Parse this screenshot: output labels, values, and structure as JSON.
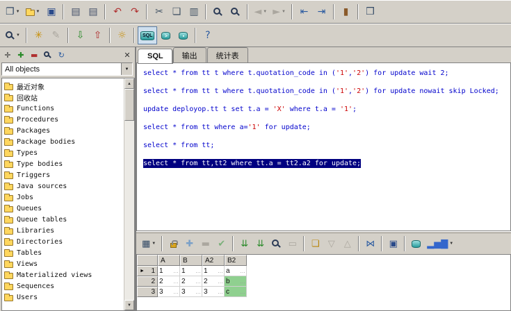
{
  "icons": {
    "dropdown": "▼",
    "row_marker": "►",
    "scroll_up": "▲",
    "scroll_down": "▼"
  },
  "toolbar_main": {
    "groups": [
      [
        {
          "name": "new-file",
          "g": "❐",
          "c": "#334a66",
          "dd": true
        },
        {
          "name": "open-file",
          "k": "folder",
          "dd": true
        },
        {
          "name": "save",
          "g": "▣",
          "c": "#2a4a8a"
        }
      ],
      [
        {
          "name": "print",
          "g": "▤",
          "c": "#44506a"
        },
        {
          "name": "print-options",
          "g": "▤",
          "c": "#44506a"
        }
      ],
      [
        {
          "name": "undo",
          "g": "↶",
          "c": "#b03030"
        },
        {
          "name": "redo",
          "g": "↷",
          "c": "#b03030"
        }
      ],
      [
        {
          "name": "cut",
          "g": "✂",
          "c": "#445566"
        },
        {
          "name": "copy",
          "g": "❏",
          "c": "#445566"
        },
        {
          "name": "paste",
          "g": "▥",
          "c": "#445566"
        }
      ],
      [
        {
          "name": "find",
          "k": "mag"
        },
        {
          "name": "find-next",
          "k": "mag"
        }
      ],
      [
        {
          "name": "back",
          "g": "◄",
          "dis": true,
          "dd": true
        },
        {
          "name": "forward",
          "g": "►",
          "dis": true,
          "dd": true
        }
      ],
      [
        {
          "name": "unindent",
          "g": "⇤",
          "c": "#2a5aa0"
        },
        {
          "name": "indent",
          "g": "⇥",
          "c": "#2a5aa0"
        }
      ],
      [
        {
          "name": "exit",
          "g": "▮",
          "c": "#8a5a2a"
        }
      ],
      [
        {
          "name": "window-list",
          "g": "❒",
          "c": "#334a66"
        }
      ]
    ]
  },
  "toolbar_tools": {
    "groups": [
      [
        {
          "name": "browser-filter",
          "k": "mag",
          "dd": true
        }
      ],
      [
        {
          "name": "preferences",
          "g": "✳",
          "c": "#c8900a"
        },
        {
          "name": "edit-object",
          "g": "✎",
          "dis": true
        }
      ],
      [
        {
          "name": "commit",
          "g": "⇩",
          "c": "#2a8a2a"
        },
        {
          "name": "rollback",
          "g": "⇧",
          "c": "#b03030"
        }
      ],
      [
        {
          "name": "sessions",
          "g": "☼",
          "c": "#c8900a"
        }
      ],
      [
        {
          "name": "sql-window",
          "k": "sql",
          "label": "SQL",
          "pressed": true
        },
        {
          "name": "command-window",
          "k": "cyl",
          "mark": ">"
        },
        {
          "name": "report-window",
          "k": "cyl",
          "mark": "▪"
        }
      ],
      [
        {
          "name": "help",
          "g": "?",
          "c": "#2a5aa0"
        }
      ]
    ]
  },
  "sidebar": {
    "toolbar": [
      {
        "name": "pin",
        "g": "✛",
        "c": "#333333"
      },
      {
        "name": "add",
        "g": "✚",
        "c": "#2a8a2a"
      },
      {
        "name": "remove",
        "g": "▬",
        "c": "#b03030"
      },
      {
        "name": "find-object",
        "k": "mag"
      },
      {
        "name": "refresh",
        "g": "↻",
        "c": "#2a5aa0"
      }
    ],
    "close": {
      "name": "close-panel",
      "g": "✕",
      "c": "#333333"
    },
    "filter": "All objects",
    "tree": [
      "最近对象",
      "回收站",
      "Functions",
      "Procedures",
      "Packages",
      "Package bodies",
      "Types",
      "Type bodies",
      "Triggers",
      "Java sources",
      "Jobs",
      "Queues",
      "Queue tables",
      "Libraries",
      "Directories",
      "Tables",
      "Views",
      "Materialized views",
      "Sequences",
      "Users"
    ]
  },
  "tabs": [
    {
      "id": "sql",
      "label": "SQL",
      "active": true
    },
    {
      "id": "output",
      "label": "输出",
      "active": false
    },
    {
      "id": "stats",
      "label": "统计表",
      "active": false
    }
  ],
  "editor": {
    "lines": [
      {
        "segs": [
          {
            "t": "select * from tt t where t.quotation_code in (",
            "c": "k"
          },
          {
            "t": "'1'",
            "c": "s"
          },
          {
            "t": ",",
            "c": "k"
          },
          {
            "t": "'2'",
            "c": "s"
          },
          {
            "t": ") for update wait 2;",
            "c": "k"
          }
        ]
      },
      {
        "segs": []
      },
      {
        "segs": [
          {
            "t": "select * from tt t where t.quotation_code in (",
            "c": "k"
          },
          {
            "t": "'1'",
            "c": "s"
          },
          {
            "t": ",",
            "c": "k"
          },
          {
            "t": "'2'",
            "c": "s"
          },
          {
            "t": ") for update nowait skip Locked;",
            "c": "k"
          }
        ]
      },
      {
        "segs": []
      },
      {
        "segs": [
          {
            "t": "update deployop.tt t set t.a = ",
            "c": "k"
          },
          {
            "t": "'X'",
            "c": "s"
          },
          {
            "t": " where t.a = ",
            "c": "k"
          },
          {
            "t": "'1'",
            "c": "s"
          },
          {
            "t": ";",
            "c": "k"
          }
        ]
      },
      {
        "segs": []
      },
      {
        "segs": [
          {
            "t": "select * from tt where a=",
            "c": "k"
          },
          {
            "t": "'1'",
            "c": "s"
          },
          {
            "t": " for update;",
            "c": "k"
          }
        ]
      },
      {
        "segs": []
      },
      {
        "segs": [
          {
            "t": "select * from tt;",
            "c": "k"
          }
        ]
      },
      {
        "segs": []
      },
      {
        "sel": true,
        "segs": [
          {
            "t": "select * from tt,tt2 where tt.a = tt2.a2 for update;",
            "c": "k"
          }
        ]
      }
    ]
  },
  "results": {
    "toolbar": {
      "groups": [
        [
          {
            "name": "grid-mode",
            "g": "▦",
            "c": "#334a66",
            "dd": true
          }
        ],
        [
          {
            "name": "lock",
            "k": "lock"
          },
          {
            "name": "insert-record",
            "g": "✚",
            "c": "#7aa0c8"
          },
          {
            "name": "delete-record",
            "g": "▬",
            "dis": true
          },
          {
            "name": "post-edit",
            "g": "✔",
            "c": "#7ab07a"
          }
        ],
        [
          {
            "name": "fetch-next-page",
            "g": "⇊",
            "c": "#2a8a2a"
          },
          {
            "name": "fetch-all",
            "g": "⇊",
            "c": "#2a8a2a"
          },
          {
            "name": "find-data",
            "k": "mag"
          },
          {
            "name": "clear",
            "g": "▭",
            "dis": true
          }
        ],
        [
          {
            "name": "export-results",
            "g": "❏",
            "c": "#b8860b"
          },
          {
            "name": "sort-desc",
            "g": "▽",
            "dis": true
          },
          {
            "name": "sort-asc",
            "g": "△",
            "dis": true
          }
        ],
        [
          {
            "name": "single-record-view",
            "g": "⋈",
            "c": "#2a5aa0"
          }
        ],
        [
          {
            "name": "save-results",
            "g": "▣",
            "c": "#2a4a8a"
          }
        ],
        [
          {
            "name": "export-db",
            "k": "cyl"
          },
          {
            "name": "chart",
            "g": "▂▅▇",
            "c": "#3366cc",
            "dd": true
          }
        ]
      ]
    },
    "grid": {
      "columns": [
        "A",
        "B",
        "A2",
        "B2"
      ],
      "rows": [
        {
          "num": "1",
          "marker": true,
          "cells": [
            {
              "v": "1"
            },
            {
              "v": "1"
            },
            {
              "v": "1"
            },
            {
              "v": "a"
            }
          ]
        },
        {
          "num": "2",
          "marker": false,
          "cells": [
            {
              "v": "2"
            },
            {
              "v": "2"
            },
            {
              "v": "2"
            },
            {
              "v": "b",
              "green": true
            }
          ]
        },
        {
          "num": "3",
          "marker": false,
          "cells": [
            {
              "v": "3"
            },
            {
              "v": "3"
            },
            {
              "v": "3"
            },
            {
              "v": "c",
              "green": true
            }
          ]
        }
      ]
    }
  },
  "colors": {
    "selection_bg": "#000080",
    "keyword": "#0000cc",
    "string": "#cc0000",
    "green_cell": "#8fd08f"
  }
}
